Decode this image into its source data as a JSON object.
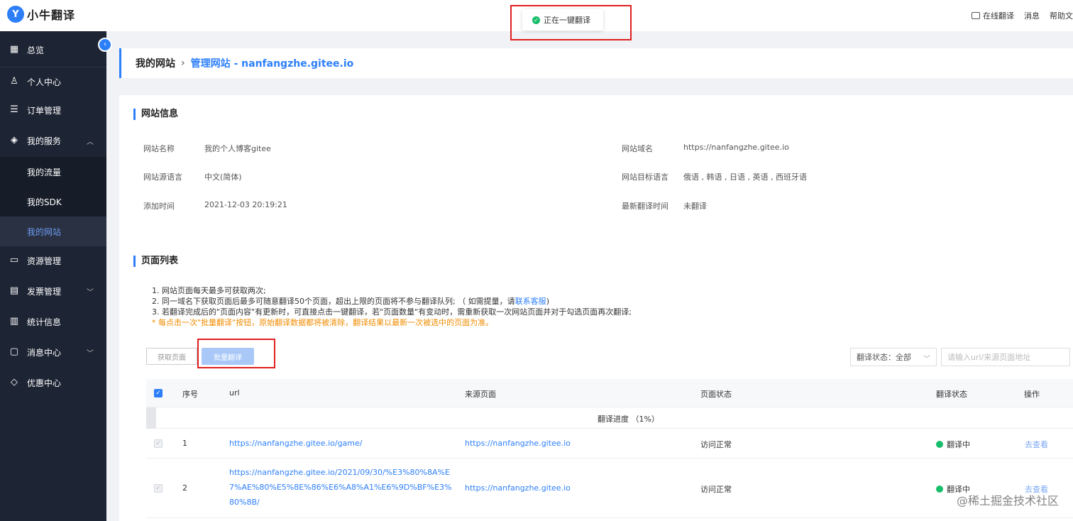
{
  "header": {
    "logo_mark": "Y",
    "logo_text": "小牛翻译",
    "links": [
      "在线翻译",
      "消息",
      "帮助文"
    ]
  },
  "toast": {
    "text": "正在一键翻译"
  },
  "sidebar": {
    "items": [
      {
        "label": "总览",
        "icon": "grid-icon"
      },
      {
        "label": "个人中心",
        "icon": "user-icon"
      },
      {
        "label": "订单管理",
        "icon": "list-icon"
      },
      {
        "label": "我的服务",
        "icon": "box-icon"
      },
      {
        "label": "资源管理",
        "icon": "folder-icon"
      },
      {
        "label": "发票管理",
        "icon": "invoice-icon"
      },
      {
        "label": "统计信息",
        "icon": "chart-icon"
      },
      {
        "label": "消息中心",
        "icon": "message-icon"
      },
      {
        "label": "优惠中心",
        "icon": "tag-icon"
      }
    ],
    "sub_items": [
      "我的流量",
      "我的SDK",
      "我的网站"
    ]
  },
  "breadcrumb": {
    "parent": "我的网站",
    "current": "管理网站 - nanfangzhe.gitee.io"
  },
  "site_info": {
    "title": "网站信息",
    "name_label": "网站名称",
    "name_value": "我的个人博客gitee",
    "domain_label": "网站域名",
    "domain_value": "https://nanfangzhe.gitee.io",
    "src_lang_label": "网站源语言",
    "src_lang_value": "中文(简体)",
    "target_lang_label": "网站目标语言",
    "target_lang_value": "俄语 , 韩语 , 日语 , 英语 , 西班牙语",
    "added_label": "添加时间",
    "added_value": "2021-12-03 20:19:21",
    "latest_label": "最新翻译时间",
    "latest_value": "未翻译"
  },
  "page_list": {
    "title": "页面列表",
    "note1": "1. 网站页面每天最多可获取两次;",
    "note2": "2. 同一域名下获取页面后最多可随意翻译50个页面，超出上限的页面将不参与翻译队列;  （ 如需提量，请",
    "note2_link": "联系客服",
    "note2_end": ")",
    "note3": "3. 若翻译完成后的\"页面内容\"有更新时，可直接点击一键翻译，若\"页面数量\"有变动时，需重新获取一次网站页面并对于勾选页面再次翻译;",
    "warning": "* 每点击一次\"批量翻译\"按钮，原始翻译数据都将被清除，翻译结果以最新一次被选中的页面为准。",
    "fetch_button": "获取页面",
    "batch_button": "批量翻译",
    "status_filter": "翻译状态：全部",
    "search_placeholder": "请输入url/来源页面地址"
  },
  "table": {
    "headers": [
      "序号",
      "url",
      "来源页面",
      "页面状态",
      "翻译状态",
      "操作"
    ],
    "progress": "翻译进度 （1%）",
    "rows": [
      {
        "index": "1",
        "url": "https://nanfangzhe.gitee.io/game/",
        "source": "https://nanfangzhe.gitee.io",
        "page_status": "访问正常",
        "trans_status": "翻译中",
        "action": "去查看"
      },
      {
        "index": "2",
        "url": "https://nanfangzhe.gitee.io/2021/09/30/%E3%80%8A%E7%AE%80%E5%8E%86%E6%A8%A1%E6%9D%BF%E3%80%8B/",
        "source": "https://nanfangzhe.gitee.io",
        "page_status": "访问正常",
        "trans_status": "翻译中",
        "action": "去查看"
      }
    ]
  },
  "watermark": "@稀土掘金技术社区",
  "colors": {
    "accent": "#2d7ff9",
    "sidebar_bg": "#1d2433",
    "success": "#19be6b",
    "warning": "#f08c00",
    "annotation": "#e02020"
  }
}
